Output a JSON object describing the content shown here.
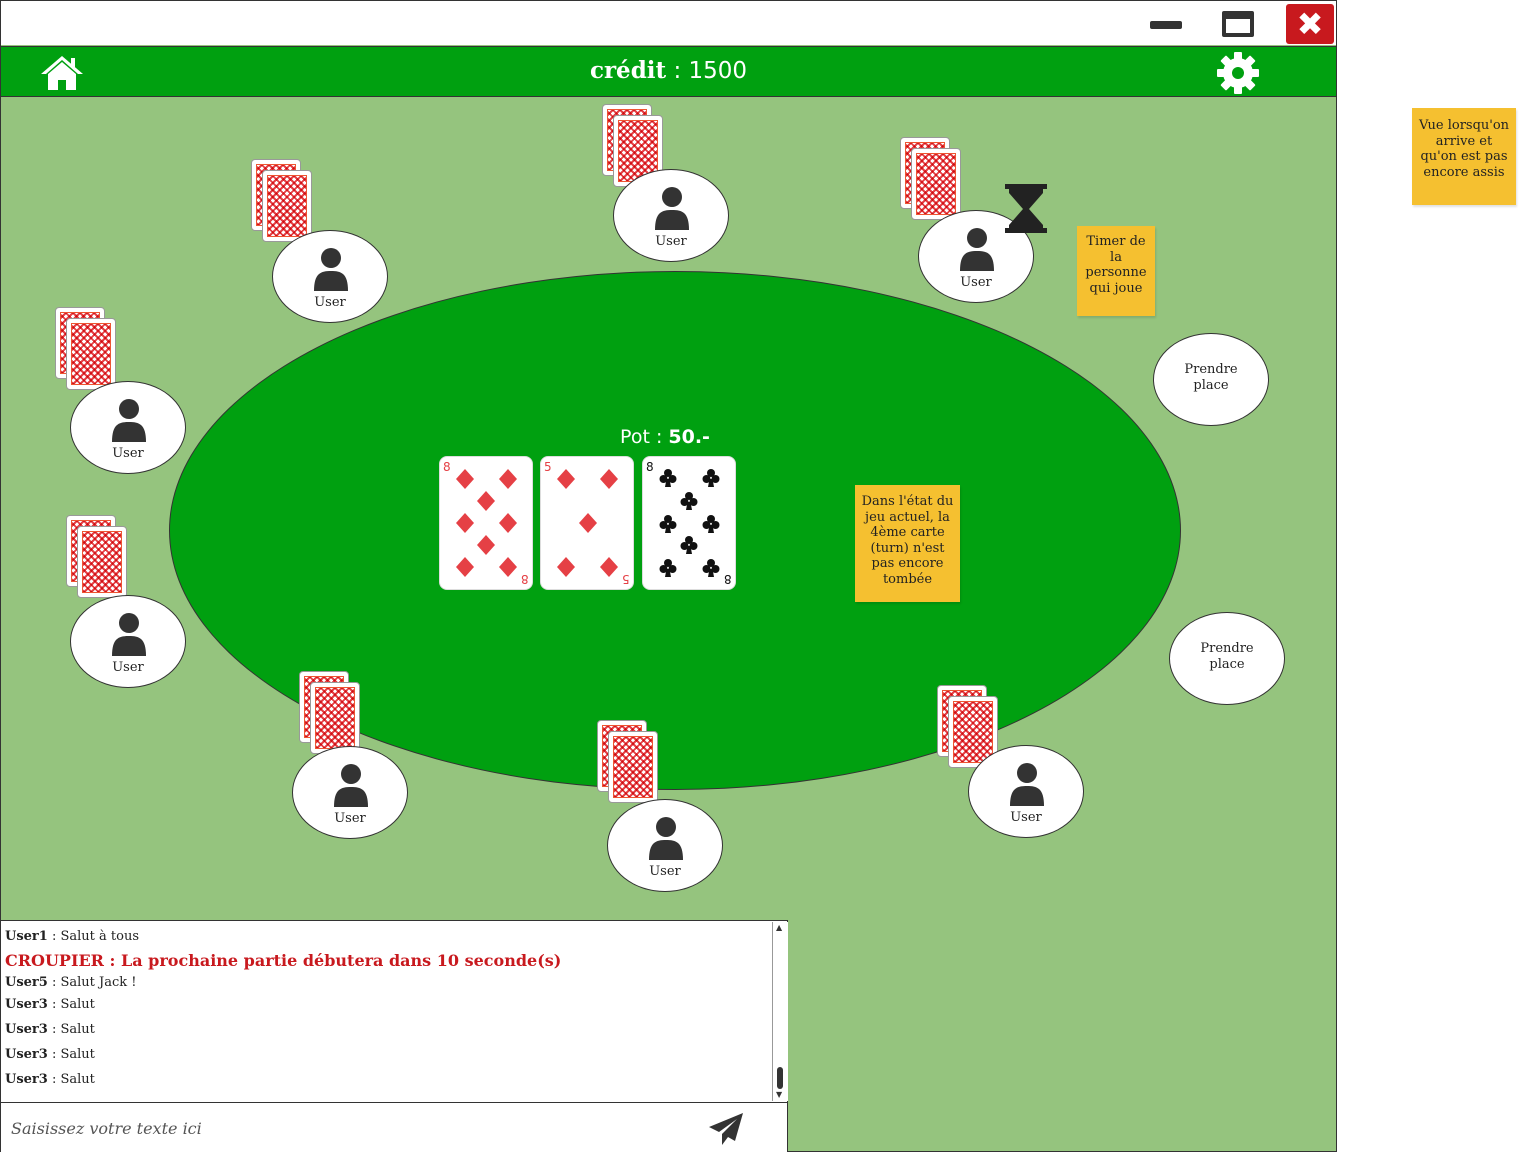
{
  "window": {
    "close_label": "✖"
  },
  "header": {
    "credit_label": "crédit",
    "credit_separator": " : ",
    "credit_value": "1500"
  },
  "table": {
    "pot_label": "Pot : ",
    "pot_value": "50.-",
    "community_cards": [
      {
        "rank": "8",
        "suit": "diamonds",
        "color": "#e54045"
      },
      {
        "rank": "5",
        "suit": "diamonds",
        "color": "#e54045"
      },
      {
        "rank": "8",
        "suit": "clubs",
        "color": "#111111"
      }
    ]
  },
  "seats": [
    {
      "label": "User",
      "state": "occupied"
    },
    {
      "label": "User",
      "state": "occupied"
    },
    {
      "label": "User",
      "state": "occupied",
      "timer": true
    },
    {
      "label": "User",
      "state": "occupied"
    },
    {
      "label": "User",
      "state": "occupied"
    },
    {
      "label": "User",
      "state": "occupied"
    },
    {
      "label": "User",
      "state": "occupied"
    },
    {
      "label": "User",
      "state": "occupied"
    },
    {
      "label": "Prendre place",
      "state": "empty"
    },
    {
      "label": "Prendre place",
      "state": "empty"
    }
  ],
  "notes": {
    "timer_note": "Timer de la personne qui joue",
    "turn_note": "Dans l'état du jeu actuel, la 4ème carte (turn) n'est pas encore tombée",
    "view_note": "Vue lorsqu'on arrive et qu'on est pas encore assis"
  },
  "chat": {
    "messages": [
      {
        "user": "User1",
        "text": " : Salut à tous"
      },
      {
        "user": "User5",
        "text": " : Salut Jack !"
      },
      {
        "user": "User3",
        "text": " : Salut"
      },
      {
        "user": "User3",
        "text": " : Salut"
      },
      {
        "user": "User3",
        "text": " : Salut"
      },
      {
        "user": "User3",
        "text": " : Salut"
      }
    ],
    "croupier_message": "CROUPIER : La prochaine partie débutera dans 10 seconde(s)",
    "input_placeholder": "Saisissez votre texte ici"
  },
  "colors": {
    "felt": "#95c47e",
    "table": "#00a010",
    "header": "#00a010",
    "close": "#c8191e",
    "note": "#f5c030",
    "card_back": "#e54045"
  },
  "icons": {
    "home": "home-icon",
    "settings": "gear-icon",
    "timer": "hourglass-icon",
    "send": "send-icon",
    "user": "user-icon"
  }
}
